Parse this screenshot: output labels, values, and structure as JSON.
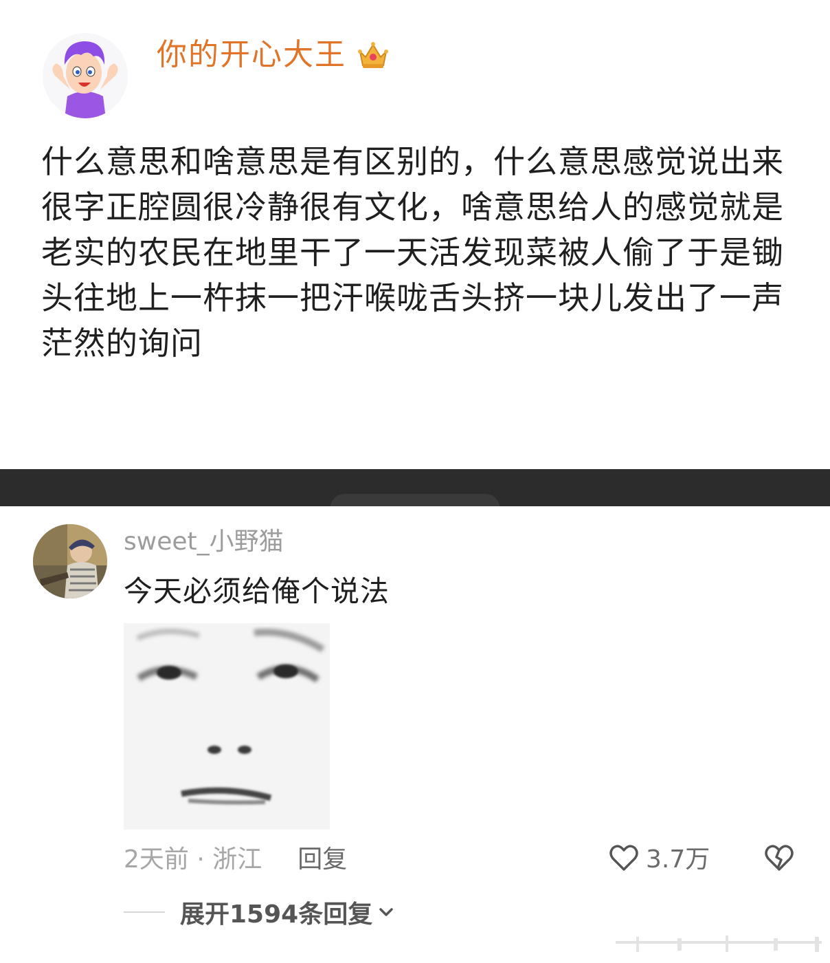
{
  "post": {
    "author_name": "你的开心大王",
    "author_badge_icon": "crown-icon",
    "text": "什么意思和啥意思是有区别的，什么意思感觉说出来很字正腔圆很冷静很有文化，啥意思给人的感觉就是老实的农民在地里干了一天活发现菜被人偷了于是锄头往地上一杵抹一把汗喉咙舌头挤一块儿发出了一声茫然的询问"
  },
  "comment": {
    "username": "sweet_小野猫",
    "text": "今天必须给俺个说法",
    "time_location": "2天前 · 浙江",
    "reply_label": "回复",
    "like_count": "3.7万",
    "expand_label": "展开1594条回复"
  },
  "colors": {
    "author_name": "#e0752a",
    "divider": "#2c2c2c",
    "muted_text": "#a6a6a6"
  }
}
